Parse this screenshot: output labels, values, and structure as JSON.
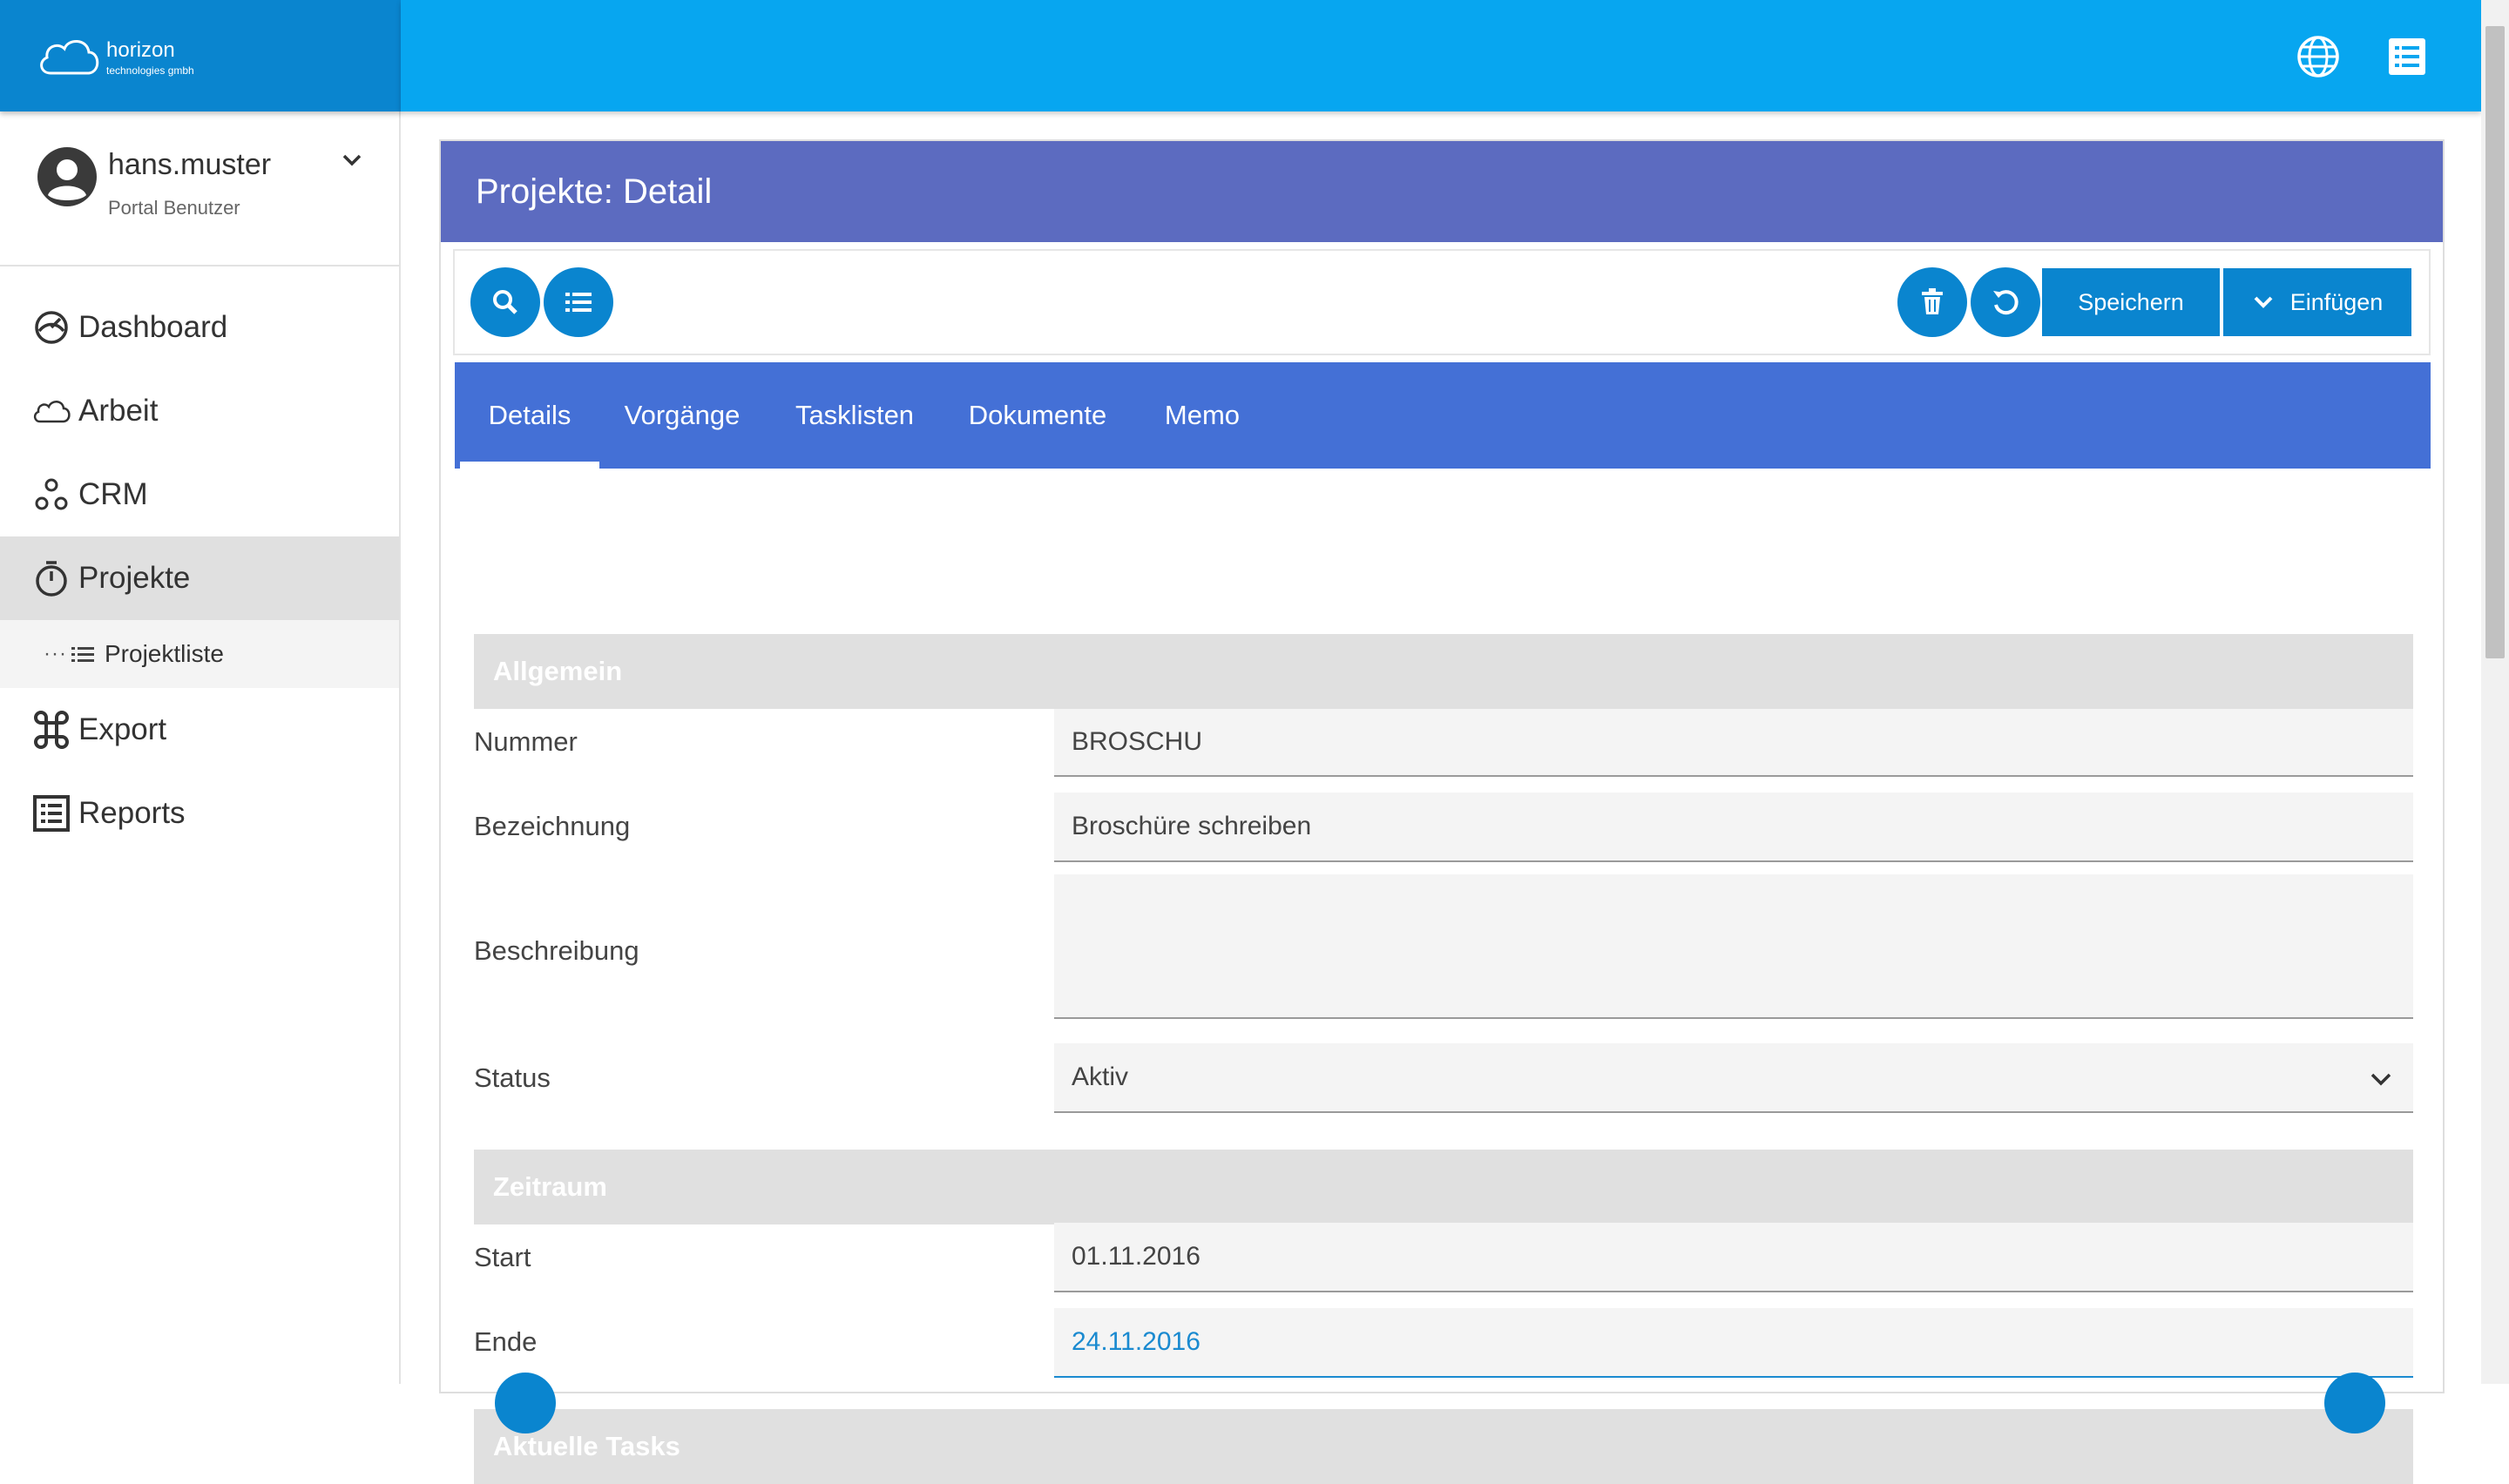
{
  "brand": {
    "name": "horizon",
    "subtitle": "technologies gmbh"
  },
  "user": {
    "name": "hans.muster",
    "role": "Portal Benutzer"
  },
  "nav": {
    "items": [
      {
        "label": "Dashboard",
        "icon": "dashboard-icon"
      },
      {
        "label": "Arbeit",
        "icon": "cloud-icon"
      },
      {
        "label": "CRM",
        "icon": "network-icon"
      },
      {
        "label": "Projekte",
        "icon": "stopwatch-icon",
        "active": true
      },
      {
        "label": "Export",
        "icon": "command-icon"
      },
      {
        "label": "Reports",
        "icon": "report-list-icon"
      }
    ],
    "sub_items": [
      {
        "label": "Projektliste",
        "icon": "list-icon"
      }
    ]
  },
  "topbar": {
    "icons": [
      "globe-icon",
      "list-icon"
    ]
  },
  "panel": {
    "title": "Projekte: Detail"
  },
  "toolbar": {
    "left_icons": [
      "search-icon",
      "list-icon"
    ],
    "right_icons": [
      "trash-icon",
      "undo-icon"
    ],
    "save_label": "Speichern",
    "insert_label": "Einfügen"
  },
  "tabs": [
    {
      "label": "Details",
      "active": true
    },
    {
      "label": "Vorgänge"
    },
    {
      "label": "Tasklisten"
    },
    {
      "label": "Dokumente"
    },
    {
      "label": "Memo"
    }
  ],
  "form": {
    "section_general": "Allgemein",
    "nummer": {
      "label": "Nummer",
      "value": "BROSCHU"
    },
    "bezeichnung": {
      "label": "Bezeichnung",
      "value": "Broschüre schreiben"
    },
    "beschreibung": {
      "label": "Beschreibung",
      "value": ""
    },
    "status": {
      "label": "Status",
      "value": "Aktiv"
    },
    "section_period": "Zeitraum",
    "start": {
      "label": "Start",
      "value": "01.11.2016"
    },
    "ende": {
      "label": "Ende",
      "value": "24.11.2016"
    },
    "section_tasks": "Aktuelle Tasks"
  },
  "colors": {
    "brand": "#0a85cf",
    "topbar": "#07a6f0",
    "panel_header": "#5c6bc0",
    "tabs": "#4470d6",
    "section": "#e0e0e0",
    "focus": "#1a8ad0"
  }
}
